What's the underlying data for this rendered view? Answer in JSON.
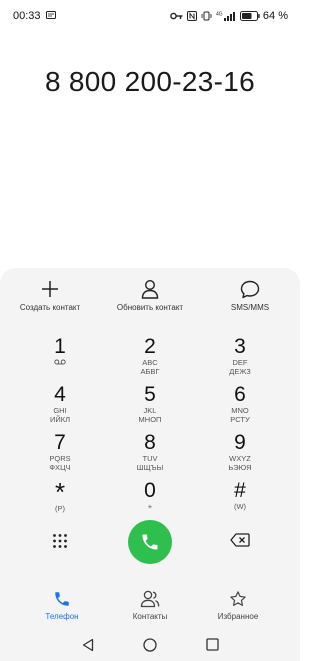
{
  "status": {
    "time": "00:33",
    "battery_pct": "64 %",
    "network": "4G"
  },
  "dialer": {
    "number": "8 800 200-23-16"
  },
  "actions": [
    {
      "label": "Создать контакт",
      "icon": "plus-icon"
    },
    {
      "label": "Обновить контакт",
      "icon": "person-icon"
    },
    {
      "label": "SMS/MMS",
      "icon": "chat-bubble-icon"
    }
  ],
  "keys": [
    {
      "digit": "1",
      "sub": "voicemail"
    },
    {
      "digit": "2",
      "sub": "ABC",
      "sub2": "АБВГ"
    },
    {
      "digit": "3",
      "sub": "DEF",
      "sub2": "ДЕЖЗ"
    },
    {
      "digit": "4",
      "sub": "GHI",
      "sub2": "ИЙКЛ"
    },
    {
      "digit": "5",
      "sub": "JKL",
      "sub2": "МНОП"
    },
    {
      "digit": "6",
      "sub": "MNO",
      "sub2": "РСТУ"
    },
    {
      "digit": "7",
      "sub": "PQRS",
      "sub2": "ФХЦЧ"
    },
    {
      "digit": "8",
      "sub": "TUV",
      "sub2": "ШЩЪЫ"
    },
    {
      "digit": "9",
      "sub": "WXYZ",
      "sub2": "ЬЭЮЯ"
    },
    {
      "digit": "*",
      "sub": "(P)"
    },
    {
      "digit": "0",
      "sub": "+"
    },
    {
      "digit": "#",
      "sub": "(W)"
    }
  ],
  "tabs": [
    {
      "label": "Телефон",
      "active": true,
      "icon": "phone-icon"
    },
    {
      "label": "Контакты",
      "active": false,
      "icon": "contacts-icon"
    },
    {
      "label": "Избранное",
      "active": false,
      "icon": "star-icon"
    }
  ],
  "colors": {
    "call": "#2fbf4f",
    "active_tab": "#1976e8",
    "panel": "#f4f4f5"
  }
}
